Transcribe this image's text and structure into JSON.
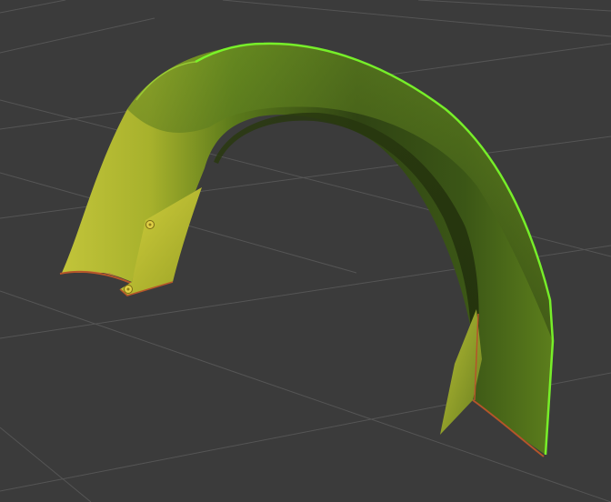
{
  "viewport": {
    "background": "#3b3b3b",
    "grid_color": "#525252"
  },
  "model": {
    "object": "fender-arch",
    "base_color": "#6d8c22",
    "highlight_color": "#a8c93a",
    "shadow_color": "#2b3a12",
    "selection_outline_color": "#7cff2a",
    "edge_rust_color": "#b5552a",
    "bolt_color": "#d4c23a"
  }
}
